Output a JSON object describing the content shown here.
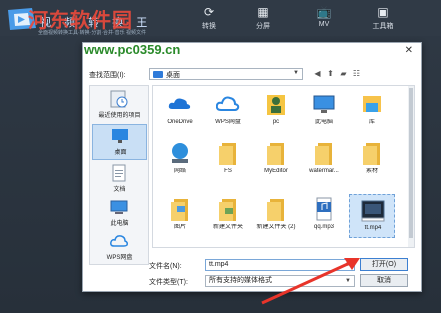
{
  "app": {
    "title": "视 频 转 换 王",
    "subtitle": "全面视频转换工具·转换·分割·合并·音乐 视频文件",
    "tabs": [
      {
        "label": "转换",
        "icon": "refresh-icon"
      },
      {
        "label": "分屏",
        "icon": "grid-icon"
      },
      {
        "label": "MV",
        "icon": "tv-icon"
      },
      {
        "label": "工具箱",
        "icon": "toolbox-icon"
      }
    ]
  },
  "watermark": {
    "brand": "河东软件园",
    "url": "www.pc0359.cn"
  },
  "dialog": {
    "close": "✕",
    "look_in_label": "查找范围(I):",
    "look_in_value": "桌面",
    "places": [
      {
        "label": "最近使用的项目",
        "icon": "recent-icon"
      },
      {
        "label": "桌面",
        "icon": "desktop-icon",
        "selected": true
      },
      {
        "label": "文档",
        "icon": "documents-icon"
      },
      {
        "label": "此电脑",
        "icon": "this-pc-icon"
      },
      {
        "label": "WPS网盘",
        "icon": "cloud-icon"
      }
    ],
    "files": [
      {
        "label": "OneDrive",
        "icon": "onedrive-icon"
      },
      {
        "label": "WPS网盘",
        "icon": "wps-cloud-icon"
      },
      {
        "label": "pc",
        "icon": "user-folder-icon"
      },
      {
        "label": "此电脑",
        "icon": "computer-icon"
      },
      {
        "label": "库",
        "icon": "library-icon"
      },
      {
        "label": "网络",
        "icon": "network-icon"
      },
      {
        "label": "FS",
        "icon": "folder-icon"
      },
      {
        "label": "MyEditor",
        "icon": "folder-icon"
      },
      {
        "label": "watermar...",
        "icon": "folder-icon"
      },
      {
        "label": "素材",
        "icon": "folder-icon"
      },
      {
        "label": "图片",
        "icon": "folder-icon"
      },
      {
        "label": "新建文件夹",
        "icon": "folder-icon"
      },
      {
        "label": "新建文件夹 (2)",
        "icon": "folder-icon"
      },
      {
        "label": "qq.mp3",
        "icon": "audio-file-icon"
      },
      {
        "label": "tt.mp4",
        "icon": "video-file-icon",
        "selected": true
      }
    ],
    "filename_label": "文件名(N):",
    "filename_value": "tt.mp4",
    "filetype_label": "文件类型(T):",
    "filetype_value": "所有支持的媒体格式",
    "open_button": "打开(O)",
    "cancel_button": "取消"
  },
  "colors": {
    "arrow": "#e8342a",
    "accent": "#3c7fd1"
  }
}
